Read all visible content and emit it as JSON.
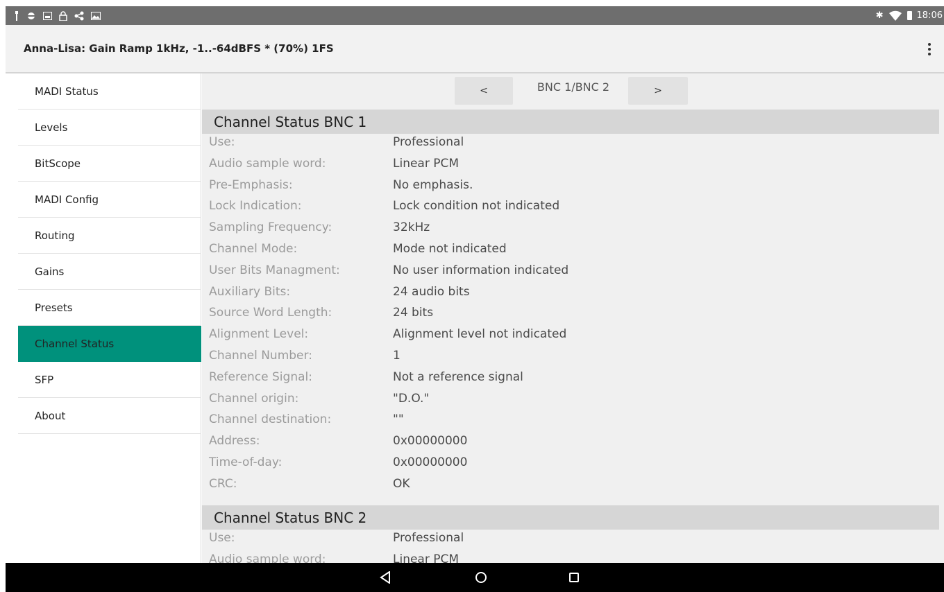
{
  "status_bar": {
    "left_icons": [
      "usb-icon",
      "android-debug-icon",
      "image-icon",
      "lock-icon",
      "share-icon",
      "photo-icon"
    ],
    "time": "18:06"
  },
  "app_bar": {
    "title": "Anna-Lisa: Gain Ramp 1kHz, -1..-64dBFS * (70%) 1FS"
  },
  "sidebar": {
    "active_color": "#00917c",
    "items": [
      {
        "label": "MADI Status"
      },
      {
        "label": "Levels"
      },
      {
        "label": "BitScope"
      },
      {
        "label": "MADI Config"
      },
      {
        "label": "Routing"
      },
      {
        "label": "Gains"
      },
      {
        "label": "Presets"
      },
      {
        "label": "Channel Status",
        "active": true
      },
      {
        "label": "SFP"
      },
      {
        "label": "About"
      }
    ]
  },
  "main": {
    "nav": {
      "prev_label": "<",
      "label": "BNC 1/BNC 2",
      "next_label": ">"
    },
    "sections": [
      {
        "title": "Channel Status BNC 1",
        "rows": [
          {
            "label": "Use:",
            "value": "Professional"
          },
          {
            "label": "Audio sample word:",
            "value": "Linear PCM"
          },
          {
            "label": "Pre-Emphasis:",
            "value": "No emphasis."
          },
          {
            "label": "Lock Indication:",
            "value": "Lock condition not indicated"
          },
          {
            "label": "Sampling Frequency:",
            "value": "32kHz"
          },
          {
            "label": "Channel Mode:",
            "value": "Mode not indicated"
          },
          {
            "label": "User Bits Managment:",
            "value": "No user information indicated"
          },
          {
            "label": "Auxiliary Bits:",
            "value": "24 audio bits"
          },
          {
            "label": "Source Word Length:",
            "value": "24 bits"
          },
          {
            "label": "Alignment Level:",
            "value": "Alignment level not indicated"
          },
          {
            "label": "Channel Number:",
            "value": "1"
          },
          {
            "label": "Reference Signal:",
            "value": "Not a reference signal"
          },
          {
            "label": "Channel origin:",
            "value": "\"D.O.\""
          },
          {
            "label": "Channel destination:",
            "value": "\"\""
          },
          {
            "label": "Address:",
            "value": "0x00000000"
          },
          {
            "label": "Time-of-day:",
            "value": "0x00000000"
          },
          {
            "label": "CRC:",
            "value": "OK"
          }
        ]
      },
      {
        "title": "Channel Status BNC 2",
        "rows": [
          {
            "label": "Use:",
            "value": "Professional"
          },
          {
            "label": "Audio sample word:",
            "value": "Linear PCM"
          }
        ]
      }
    ]
  },
  "nav_bar": {
    "buttons": [
      "back-icon",
      "home-icon",
      "recents-icon"
    ]
  }
}
